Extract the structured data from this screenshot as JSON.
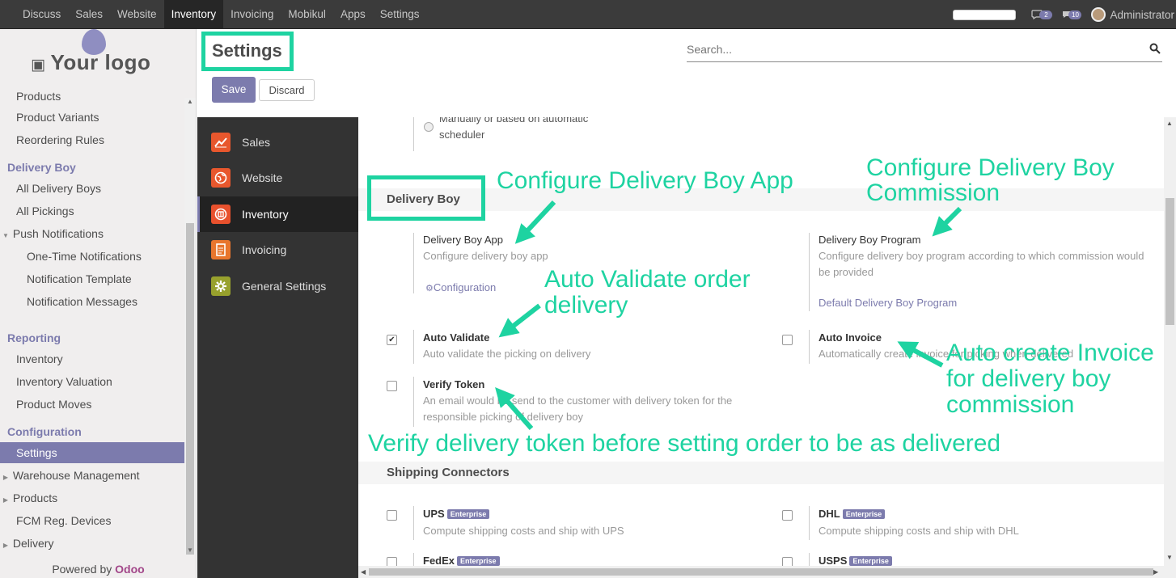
{
  "topbar": {
    "menu": [
      "Discuss",
      "Sales",
      "Website",
      "Inventory",
      "Invoicing",
      "Mobikul",
      "Apps",
      "Settings"
    ],
    "active_index": 3,
    "badge_chat": "2",
    "badge_activity": "10",
    "user": "Administrator"
  },
  "logo": {
    "text": "Your logo"
  },
  "sidebar": {
    "items": [
      {
        "label": "Products",
        "kind": "item"
      },
      {
        "label": "Product Variants",
        "kind": "item"
      },
      {
        "label": "Reordering Rules",
        "kind": "item"
      },
      {
        "label": "Delivery Boy",
        "kind": "header"
      },
      {
        "label": "All Delivery Boys",
        "kind": "item"
      },
      {
        "label": "All Pickings",
        "kind": "item"
      },
      {
        "label": "Push Notifications",
        "kind": "expanded"
      },
      {
        "label": "One-Time Notifications",
        "kind": "sub"
      },
      {
        "label": "Notification Template",
        "kind": "sub"
      },
      {
        "label": "Notification Messages",
        "kind": "sub"
      },
      {
        "label": "Reporting",
        "kind": "header"
      },
      {
        "label": "Inventory",
        "kind": "item"
      },
      {
        "label": "Inventory Valuation",
        "kind": "item"
      },
      {
        "label": "Product Moves",
        "kind": "item"
      },
      {
        "label": "Configuration",
        "kind": "header"
      },
      {
        "label": "Settings",
        "kind": "selected"
      },
      {
        "label": "Warehouse Management",
        "kind": "collapsed"
      },
      {
        "label": "Products",
        "kind": "collapsed"
      },
      {
        "label": "FCM Reg. Devices",
        "kind": "item"
      },
      {
        "label": "Delivery",
        "kind": "collapsed"
      }
    ],
    "powered_prefix": "Powered by",
    "powered_brand": "Odoo"
  },
  "control": {
    "title": "Settings",
    "save_label": "Save",
    "discard_label": "Discard",
    "search_placeholder": "Search..."
  },
  "settings_nav": [
    {
      "label": "Sales",
      "icon": "sales-chart-icon",
      "color": "#e8572d"
    },
    {
      "label": "Website",
      "icon": "globe-icon",
      "color": "#e8572d"
    },
    {
      "label": "Inventory",
      "icon": "warehouse-icon",
      "color": "#e8512d"
    },
    {
      "label": "Invoicing",
      "icon": "invoice-icon",
      "color": "#e8762d"
    },
    {
      "label": "General Settings",
      "icon": "gear-icon",
      "color": "#98a12d"
    }
  ],
  "settings_nav_active": 2,
  "content": {
    "top_radio": "Manually or based on automatic scheduler",
    "delivery_section": "Delivery Boy",
    "app_label": "Delivery Boy App",
    "app_desc": "Configure delivery boy app",
    "app_link": "Configuration",
    "program_label": "Delivery Boy Program",
    "program_desc": "Configure delivery boy program according to which commission would be provided",
    "program_link": "Default Delivery Boy Program",
    "auto_validate_label": "Auto Validate",
    "auto_validate_desc": "Auto validate the picking on delivery",
    "auto_validate_checked": true,
    "auto_invoice_label": "Auto Invoice",
    "auto_invoice_desc": "Automatically create invoice for picking when delivered",
    "verify_token_label": "Verify Token",
    "verify_token_desc": "An email would be send to the customer with delivery token for the responsible picking of delivery boy",
    "shipping_section": "Shipping Connectors",
    "enterprise": "Enterprise",
    "ups_label": "UPS",
    "ups_desc": "Compute shipping costs and ship with UPS",
    "dhl_label": "DHL",
    "dhl_desc": "Compute shipping costs and ship with DHL",
    "fedex_label": "FedEx",
    "usps_label": "USPS"
  },
  "annotations": {
    "configure_app": "Configure Delivery Boy App",
    "commission_1": "Configure Delivery Boy",
    "commission_2": "Commission",
    "validate_1": "Auto Validate order",
    "validate_2": "delivery",
    "invoice_1": "Auto create Invoice",
    "invoice_2": "for delivery boy",
    "invoice_3": "commission",
    "verify": "Verify delivery token before setting order to be as delivered",
    "color": "#1ed3a1"
  }
}
